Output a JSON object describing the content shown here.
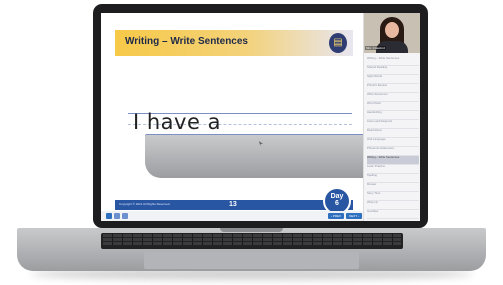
{
  "slide": {
    "title": "Writing – Write Sentences",
    "writing_text": "I have a",
    "footer_copyright": "Copyright © 2021 All Rights Reserved.",
    "page_number": "13",
    "day_label": "Day",
    "day_number": "6"
  },
  "presenter": {
    "name": "Mrs. Crawford"
  },
  "toolbar": {
    "prev_label": "‹ PREV",
    "next_label": "NEXT ›"
  },
  "panel_items": [
    "Writing – Write Sentences",
    "Shared Reading",
    "Sight Words",
    "Phonics Review",
    "Write Sentences",
    "Word Work",
    "Handwriting",
    "Listen and Respond",
    "Read Aloud",
    "Oral Language",
    "Phonemic Awareness",
    "Writing – Write Sentences",
    "Letter Practice",
    "Spelling",
    "Review",
    "Story Time",
    "Wrap Up",
    "Goodbye"
  ],
  "colors": {
    "accent": "#2856a3",
    "header_yellow": "#f7c948"
  }
}
